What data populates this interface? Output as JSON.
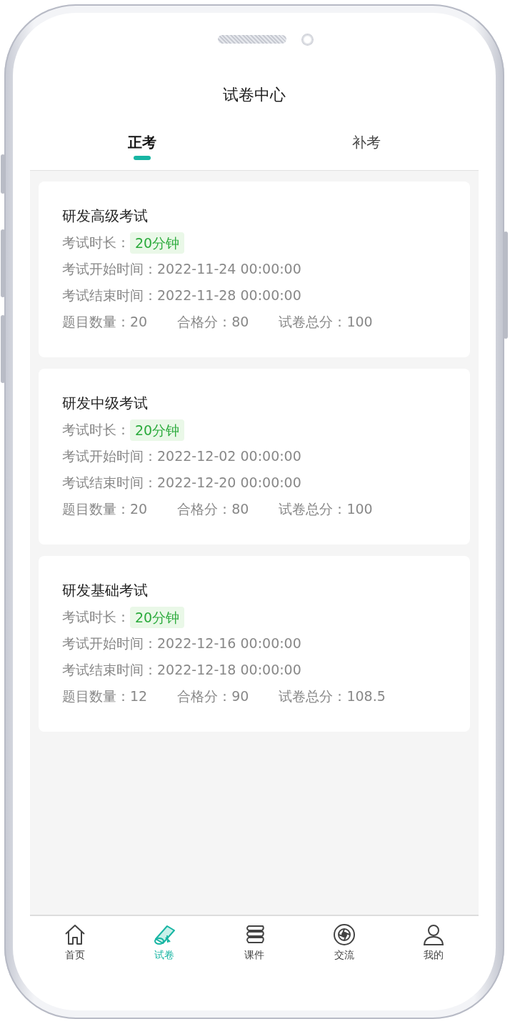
{
  "title": "试卷中心",
  "tabs": [
    {
      "label": "正考",
      "selected": true
    },
    {
      "label": "补考",
      "selected": false
    }
  ],
  "exams": [
    {
      "name": "研发高级考试",
      "duration_label": "考试时长：",
      "duration": "20分钟",
      "start": "考试开始时间：2022-11-24 00:00:00",
      "end": "考试结束时间：2022-11-28 00:00:00",
      "stats": [
        "题目数量：20",
        "合格分：80",
        "试卷总分：100"
      ]
    },
    {
      "name": "研发中级考试",
      "duration_label": "考试时长：",
      "duration": "20分钟",
      "start": "考试开始时间：2022-12-02 00:00:00",
      "end": "考试结束时间：2022-12-20 00:00:00",
      "stats": [
        "题目数量：20",
        "合格分：80",
        "试卷总分：100"
      ]
    },
    {
      "name": "研发基础考试",
      "duration_label": "考试时长：",
      "duration": "20分钟",
      "start": "考试开始时间：2022-12-16 00:00:00",
      "end": "考试结束时间：2022-12-18 00:00:00",
      "stats": [
        "题目数量：12",
        "合格分：90",
        "试卷总分：108.5"
      ]
    }
  ],
  "nav": [
    {
      "label": "首页",
      "selected": false
    },
    {
      "label": "试卷",
      "selected": true
    },
    {
      "label": "课件",
      "selected": false
    },
    {
      "label": "交流",
      "selected": false
    },
    {
      "label": "我的",
      "selected": false
    }
  ]
}
